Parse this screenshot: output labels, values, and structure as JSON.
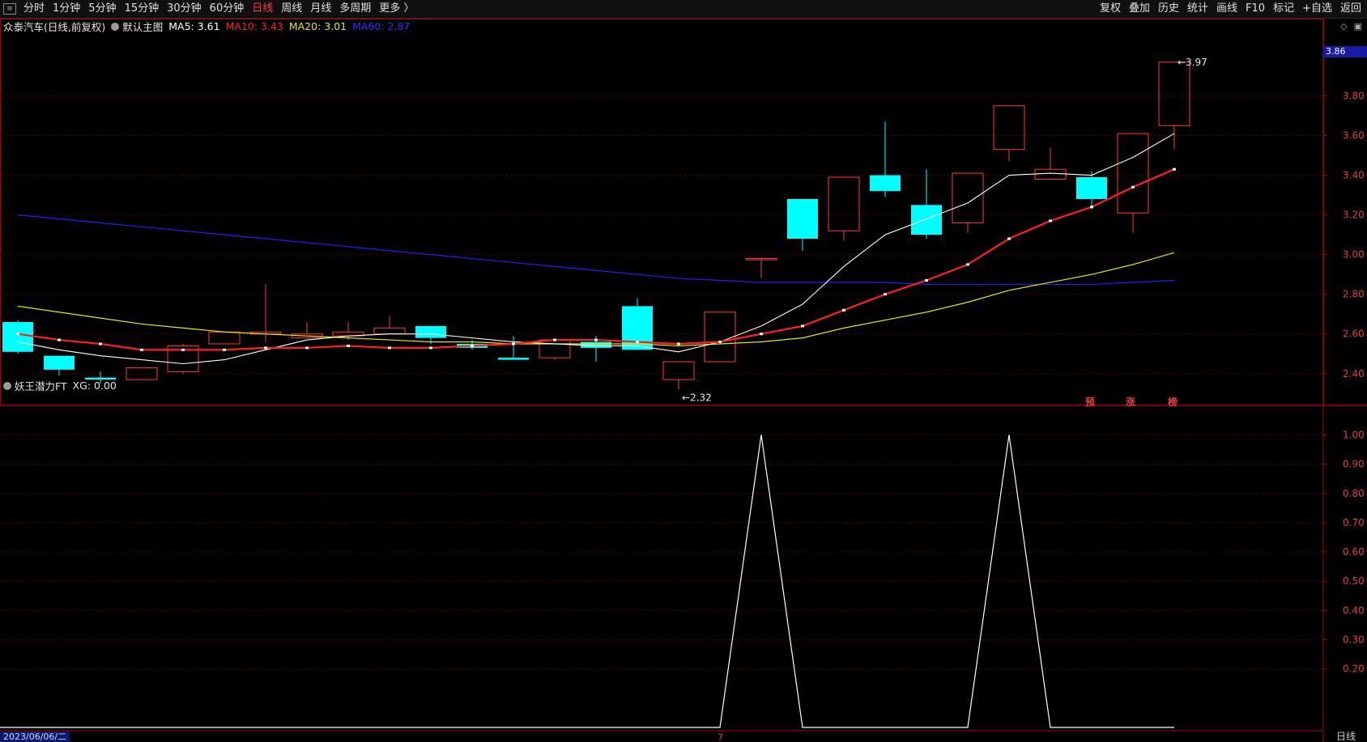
{
  "toolbar": {
    "left_items": [
      {
        "label": "分时",
        "active": false
      },
      {
        "label": "1分钟",
        "active": false
      },
      {
        "label": "5分钟",
        "active": false
      },
      {
        "label": "15分钟",
        "active": false
      },
      {
        "label": "30分钟",
        "active": false
      },
      {
        "label": "60分钟",
        "active": false
      },
      {
        "label": "日线",
        "active": true
      },
      {
        "label": "周线",
        "active": false
      },
      {
        "label": "月线",
        "active": false
      },
      {
        "label": "多周期",
        "active": false
      },
      {
        "label": "更多 〉",
        "active": false
      }
    ],
    "right_items": [
      "复权",
      "叠加",
      "历史",
      "统计",
      "画线",
      "F10",
      "标记",
      "+自选",
      "返回"
    ]
  },
  "main_header": {
    "title": "众泰汽车(日线,前复权)",
    "template": "默认主图",
    "ma5": "MA5: 3.61",
    "ma10": "MA10: 3.43",
    "ma20": "MA20: 3.01",
    "ma60": "MA60: 2.87"
  },
  "sub_header": {
    "title": "妖王潜力FT",
    "xg": "XG: 0.00"
  },
  "status": {
    "date": "2023/06/06/二",
    "period": "日线",
    "current_price": "3.86"
  },
  "tags": [
    "预",
    "涨",
    "榜"
  ],
  "colors": {
    "up": "#ff3b3b",
    "down": "#00ffff",
    "ma5": "#ffffff",
    "ma10": "#ff2020",
    "ma20": "#e8e800",
    "ma60": "#2020ff",
    "axis": "#b00000"
  },
  "chart_data": [
    {
      "type": "candlestick",
      "title": "众泰汽车(日线,前复权)",
      "ylim": [
        2.24,
        4.12
      ],
      "y_ticks": [
        2.4,
        2.6,
        2.8,
        3.0,
        3.2,
        3.4,
        3.6,
        3.8
      ],
      "candles": [
        {
          "o": 2.66,
          "c": 2.51,
          "h": 2.67,
          "l": 2.5
        },
        {
          "o": 2.49,
          "c": 2.42,
          "h": 2.49,
          "l": 2.39
        },
        {
          "o": 2.38,
          "c": 2.37,
          "h": 2.41,
          "l": 2.35
        },
        {
          "o": 2.37,
          "c": 2.43,
          "h": 2.43,
          "l": 2.37
        },
        {
          "o": 2.41,
          "c": 2.54,
          "h": 2.55,
          "l": 2.4
        },
        {
          "o": 2.55,
          "c": 2.61,
          "h": 2.61,
          "l": 2.55
        },
        {
          "o": 2.6,
          "c": 2.61,
          "h": 2.85,
          "l": 2.56
        },
        {
          "o": 2.58,
          "c": 2.6,
          "h": 2.66,
          "l": 2.58
        },
        {
          "o": 2.59,
          "c": 2.61,
          "h": 2.66,
          "l": 2.57
        },
        {
          "o": 2.6,
          "c": 2.63,
          "h": 2.69,
          "l": 2.6
        },
        {
          "o": 2.64,
          "c": 2.58,
          "h": 2.64,
          "l": 2.55
        },
        {
          "o": 2.55,
          "c": 2.53,
          "h": 2.57,
          "l": 2.52
        },
        {
          "o": 2.48,
          "c": 2.47,
          "h": 2.59,
          "l": 2.47
        },
        {
          "o": 2.48,
          "c": 2.57,
          "h": 2.58,
          "l": 2.47
        },
        {
          "o": 2.56,
          "c": 2.53,
          "h": 2.59,
          "l": 2.46
        },
        {
          "o": 2.74,
          "c": 2.52,
          "h": 2.78,
          "l": 2.52
        },
        {
          "o": 2.37,
          "c": 2.46,
          "h": 2.46,
          "l": 2.32
        },
        {
          "o": 2.46,
          "c": 2.71,
          "h": 2.71,
          "l": 2.46
        },
        {
          "o": 2.98,
          "c": 2.98,
          "h": 2.98,
          "l": 2.88
        },
        {
          "o": 3.28,
          "c": 3.08,
          "h": 3.28,
          "l": 3.02
        },
        {
          "o": 3.12,
          "c": 3.39,
          "h": 3.39,
          "l": 3.07
        },
        {
          "o": 3.4,
          "c": 3.32,
          "h": 3.67,
          "l": 3.29
        },
        {
          "o": 3.25,
          "c": 3.1,
          "h": 3.43,
          "l": 3.08
        },
        {
          "o": 3.16,
          "c": 3.41,
          "h": 3.41,
          "l": 3.11
        },
        {
          "o": 3.53,
          "c": 3.75,
          "h": 3.75,
          "l": 3.47
        },
        {
          "o": 3.38,
          "c": 3.43,
          "h": 3.54,
          "l": 3.38
        },
        {
          "o": 3.39,
          "c": 3.28,
          "h": 3.42,
          "l": 3.23
        },
        {
          "o": 3.21,
          "c": 3.61,
          "h": 3.61,
          "l": 3.11
        },
        {
          "o": 3.65,
          "c": 3.97,
          "h": 3.97,
          "l": 3.53
        }
      ],
      "ma5": [
        2.56,
        2.52,
        2.49,
        2.47,
        2.45,
        2.47,
        2.52,
        2.57,
        2.59,
        2.6,
        2.6,
        2.58,
        2.56,
        2.55,
        2.54,
        2.54,
        2.51,
        2.56,
        2.64,
        2.75,
        2.94,
        3.1,
        3.18,
        3.26,
        3.4,
        3.41,
        3.4,
        3.49,
        3.61
      ],
      "ma10": [
        2.6,
        2.57,
        2.55,
        2.52,
        2.52,
        2.52,
        2.53,
        2.53,
        2.54,
        2.53,
        2.53,
        2.54,
        2.55,
        2.57,
        2.57,
        2.56,
        2.55,
        2.56,
        2.6,
        2.64,
        2.72,
        2.8,
        2.87,
        2.95,
        3.08,
        3.17,
        3.24,
        3.34,
        3.43
      ],
      "ma20": [
        2.74,
        2.71,
        2.68,
        2.65,
        2.63,
        2.61,
        2.6,
        2.59,
        2.58,
        2.57,
        2.56,
        2.56,
        2.55,
        2.55,
        2.55,
        2.55,
        2.54,
        2.55,
        2.56,
        2.58,
        2.63,
        2.67,
        2.71,
        2.76,
        2.82,
        2.86,
        2.9,
        2.95,
        3.01
      ],
      "ma60": [
        3.2,
        3.18,
        3.16,
        3.14,
        3.12,
        3.1,
        3.08,
        3.06,
        3.04,
        3.02,
        3.0,
        2.98,
        2.96,
        2.94,
        2.92,
        2.9,
        2.88,
        2.87,
        2.86,
        2.86,
        2.86,
        2.86,
        2.85,
        2.85,
        2.85,
        2.85,
        2.85,
        2.86,
        2.87
      ],
      "annotations": [
        {
          "index": 16,
          "value": 2.32,
          "label": "2.32"
        },
        {
          "index": 28,
          "value": 3.97,
          "label": "3.97"
        }
      ]
    },
    {
      "type": "line",
      "title": "妖王潜力FT",
      "ylim": [
        0.0,
        1.04
      ],
      "y_ticks": [
        0.2,
        0.3,
        0.4,
        0.5,
        0.6,
        0.7,
        0.8,
        0.9,
        1.0
      ],
      "y_tick_labels": [
        "0.20",
        "0.30",
        "0.40",
        "0.50",
        "0.60",
        "0.70",
        "0.80",
        "0.90",
        "1.00"
      ],
      "series": [
        {
          "values": [
            0,
            0,
            0,
            0,
            0,
            0,
            0,
            0,
            0,
            0,
            0,
            0,
            0,
            0,
            0,
            0,
            0,
            0,
            1,
            0,
            0,
            0,
            0,
            0,
            1,
            0,
            0,
            0,
            0
          ]
        }
      ],
      "x_marker": "7"
    }
  ]
}
